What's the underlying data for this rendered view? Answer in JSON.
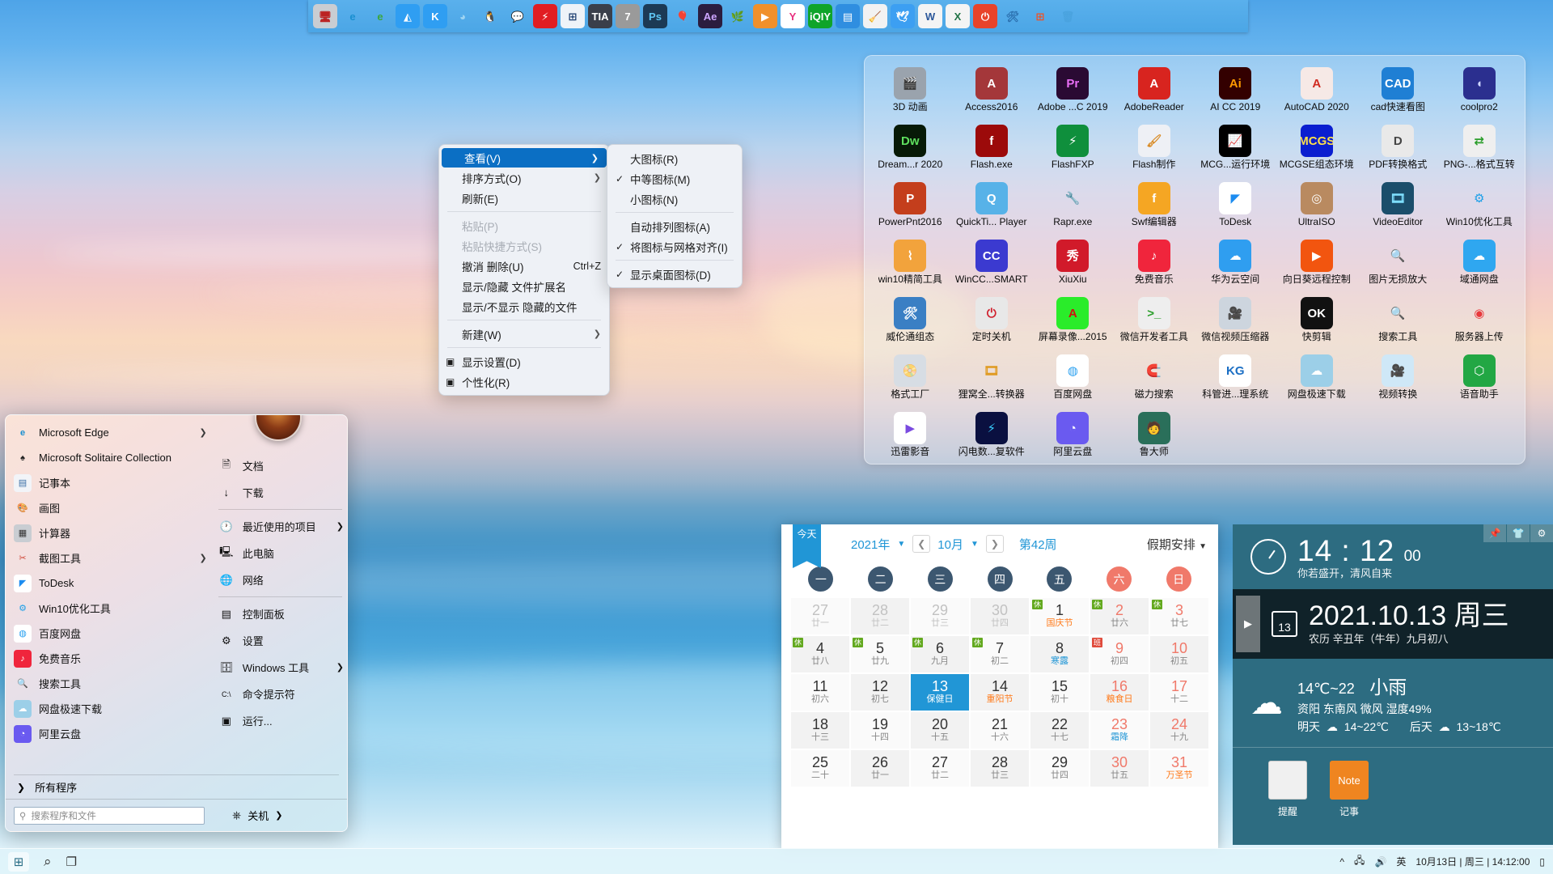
{
  "top_dock": {
    "icons": [
      {
        "name": "windows-optimizer-icon",
        "glyph": "🖥",
        "bg": "#c9cdd2",
        "fg": "#b22",
        "label": "优化大师"
      },
      {
        "name": "microsoft-edge-icon",
        "glyph": "e",
        "bg": "transparent",
        "fg": "#1a8fd0",
        "label": "Microsoft Edge"
      },
      {
        "name": "internet-explorer-icon",
        "glyph": "e",
        "bg": "transparent",
        "fg": "#3ba63b",
        "label": "Internet Explorer"
      },
      {
        "name": "maxthon-icon",
        "glyph": "◭",
        "bg": "#2f9ef2",
        "fg": "#fff",
        "label": "傲游浏览器"
      },
      {
        "name": "kingsoft-icon",
        "glyph": "K",
        "bg": "#2f9ef2",
        "fg": "#fff",
        "label": "金山"
      },
      {
        "name": "qqbrowser-icon",
        "glyph": "◕",
        "bg": "transparent",
        "fg": "#9fd4f2",
        "label": "QQ浏览器"
      },
      {
        "name": "qq-icon",
        "glyph": "🐧",
        "bg": "transparent",
        "fg": "#111",
        "label": "QQ"
      },
      {
        "name": "wechat-icon",
        "glyph": "💬",
        "bg": "transparent",
        "fg": "#3fbf4a",
        "label": "微信"
      },
      {
        "name": "danger-warning-icon",
        "glyph": "⚡",
        "bg": "#e11d22",
        "fg": "#fff",
        "label": "电工助手"
      },
      {
        "name": "plc-tool-icon",
        "glyph": "⊞",
        "bg": "#eef3f8",
        "fg": "#1a3c6e",
        "label": "PLC工具"
      },
      {
        "name": "tia-portal-v16-icon",
        "glyph": "TIA",
        "bg": "#3a3f4a",
        "fg": "#fff",
        "label": "TIA V16"
      },
      {
        "name": "step7-icon",
        "glyph": "7",
        "bg": "#9a9a9a",
        "fg": "#fff",
        "label": "STEP 7"
      },
      {
        "name": "photoshop-icon",
        "glyph": "Ps",
        "bg": "#1c3a55",
        "fg": "#5fc7f5",
        "label": "Photoshop"
      },
      {
        "name": "corel-icon",
        "glyph": "🎈",
        "bg": "transparent",
        "fg": "#e0a",
        "label": "CorelDRAW"
      },
      {
        "name": "after-effects-icon",
        "glyph": "Ae",
        "bg": "#2b1d3f",
        "fg": "#cda6ff",
        "label": "After Effects"
      },
      {
        "name": "evernote-icon",
        "glyph": "🌿",
        "bg": "transparent",
        "fg": "#7ac143",
        "label": "印象笔记"
      },
      {
        "name": "potplayer-icon",
        "glyph": "▶",
        "bg": "#f0902b",
        "fg": "#fff",
        "label": "播放器"
      },
      {
        "name": "youku-icon",
        "glyph": "Y",
        "bg": "#fff",
        "fg": "#e8317f",
        "label": "优酷"
      },
      {
        "name": "iqiyi-icon",
        "glyph": "iQIY",
        "bg": "#0fa42a",
        "fg": "#fff",
        "label": "爱奇艺"
      },
      {
        "name": "f6-tool-icon",
        "glyph": "▤",
        "bg": "#2f8ee0",
        "fg": "#fff",
        "label": "F6工具"
      },
      {
        "name": "cleaner-icon",
        "glyph": "🧹",
        "bg": "#f2f2f2",
        "fg": "#3a3",
        "label": "清理工具"
      },
      {
        "name": "swallow-icon",
        "glyph": "🕊",
        "bg": "#3c9ff2",
        "fg": "#fff",
        "label": "燕子"
      },
      {
        "name": "word-icon",
        "glyph": "W",
        "bg": "#f4f4f4",
        "fg": "#2b579a",
        "label": "Word"
      },
      {
        "name": "excel-icon",
        "glyph": "X",
        "bg": "#f4f4f4",
        "fg": "#217346",
        "label": "Excel"
      },
      {
        "name": "shutdown-icon",
        "glyph": "⏻",
        "bg": "#e8432a",
        "fg": "#fff",
        "label": "关机"
      },
      {
        "name": "toolbox-icon",
        "glyph": "🛠",
        "bg": "transparent",
        "fg": "#2b6fae",
        "label": "工具箱"
      },
      {
        "name": "windows-logo-icon",
        "glyph": "⊞",
        "bg": "transparent",
        "fg": "#f25022",
        "label": "Windows"
      },
      {
        "name": "recycle-bin-icon",
        "glyph": "🗑",
        "bg": "transparent",
        "fg": "#4aa3df",
        "label": "回收站"
      }
    ]
  },
  "desktop_icons": [
    {
      "label": "3D 动画",
      "glyph": "🎬",
      "bg": "#9aa3ad",
      "fg": "#fff"
    },
    {
      "label": "Access2016",
      "glyph": "A",
      "bg": "#a4373a",
      "fg": "#fff"
    },
    {
      "label": "Adobe ...C 2019",
      "glyph": "Pr",
      "bg": "#2a0a33",
      "fg": "#e96ef5"
    },
    {
      "label": "AdobeReader",
      "glyph": "A",
      "bg": "#d8241f",
      "fg": "#fff"
    },
    {
      "label": "AI CC 2019",
      "glyph": "Ai",
      "bg": "#330000",
      "fg": "#ff9a00"
    },
    {
      "label": "AutoCAD 2020",
      "glyph": "A",
      "bg": "#f6e9e6",
      "fg": "#d02a20"
    },
    {
      "label": "cad快速看图",
      "glyph": "CAD",
      "bg": "#1f7fd4",
      "fg": "#fff"
    },
    {
      "label": "coolpro2",
      "glyph": "◖",
      "bg": "#2b2f8f",
      "fg": "#cfd6ff"
    },
    {
      "label": "Dream...r 2020",
      "glyph": "Dw",
      "bg": "#071a07",
      "fg": "#5ee05e"
    },
    {
      "label": "Flash.exe",
      "glyph": "f",
      "bg": "#9c0a0a",
      "fg": "#fff"
    },
    {
      "label": "FlashFXP",
      "glyph": "⚡",
      "bg": "#0f8f3c",
      "fg": "#fff"
    },
    {
      "label": "Flash制作",
      "glyph": "🖌",
      "bg": "#eef0f5",
      "fg": "#d98c28"
    },
    {
      "label": "MCG...运行环境",
      "glyph": "📈",
      "bg": "#000000",
      "fg": "#2ef02e"
    },
    {
      "label": "MCGSE组态环境",
      "glyph": "MCGS",
      "bg": "#0a1ed0",
      "fg": "#ffe04a"
    },
    {
      "label": "PDF转换格式",
      "glyph": "D",
      "bg": "#e9e9e9",
      "fg": "#444"
    },
    {
      "label": "PNG-...格式互转",
      "glyph": "⇄",
      "bg": "#efefef",
      "fg": "#2b9e2b"
    },
    {
      "label": "PowerPnt2016",
      "glyph": "P",
      "bg": "#c43e1c",
      "fg": "#fff"
    },
    {
      "label": "QuickTi... Player",
      "glyph": "Q",
      "bg": "#57b2e8",
      "fg": "#fff"
    },
    {
      "label": "Rapr.exe",
      "glyph": "🔧",
      "bg": "transparent",
      "fg": "#333"
    },
    {
      "label": "Swf编辑器",
      "glyph": "f",
      "bg": "#f5a623",
      "fg": "#fff"
    },
    {
      "label": "ToDesk",
      "glyph": "◤",
      "bg": "#ffffff",
      "fg": "#1c8cf0"
    },
    {
      "label": "UltraISO",
      "glyph": "◎",
      "bg": "#b98a60",
      "fg": "#fff"
    },
    {
      "label": "VideoEditor",
      "glyph": "🎞",
      "bg": "#1b4e6b",
      "fg": "#7fe0ff"
    },
    {
      "label": "Win10优化工具",
      "glyph": "⚙",
      "bg": "transparent",
      "fg": "#1c9fe8"
    },
    {
      "label": "win10精简工具",
      "glyph": "⌇",
      "bg": "#f2a33c",
      "fg": "#fff"
    },
    {
      "label": "WinCC...SMART",
      "glyph": "CC",
      "bg": "#3b3ad0",
      "fg": "#fff"
    },
    {
      "label": "XiuXiu",
      "glyph": "秀",
      "bg": "#d11a2a",
      "fg": "#fff"
    },
    {
      "label": "免费音乐",
      "glyph": "♪",
      "bg": "#f0253c",
      "fg": "#fff"
    },
    {
      "label": "华为云空间",
      "glyph": "☁",
      "bg": "#2f9ef0",
      "fg": "#fff"
    },
    {
      "label": "向日葵远程控制",
      "glyph": "▶",
      "bg": "#f2550f",
      "fg": "#fff"
    },
    {
      "label": "图片无损放大",
      "glyph": "🔍",
      "bg": "transparent",
      "fg": "#c8a23a"
    },
    {
      "label": "域通网盘",
      "glyph": "☁",
      "bg": "#2fa7f0",
      "fg": "#fff"
    },
    {
      "label": "威伦通组态",
      "glyph": "🛠",
      "bg": "#3a7fc4",
      "fg": "#fff"
    },
    {
      "label": "定时关机",
      "glyph": "⏻",
      "bg": "#e8e8e8",
      "fg": "#d0212e"
    },
    {
      "label": "屏幕录像...2015",
      "glyph": "A",
      "bg": "#2aec2a",
      "fg": "#d01010"
    },
    {
      "label": "微信开发者工具",
      "glyph": ">_",
      "bg": "#eeeeee",
      "fg": "#2a9e2a"
    },
    {
      "label": "微信视频压缩器",
      "glyph": "🎥",
      "bg": "#cdd5de",
      "fg": "#3a4a5a"
    },
    {
      "label": "快剪辑",
      "glyph": "OK",
      "bg": "#111111",
      "fg": "#fff"
    },
    {
      "label": "搜索工具",
      "glyph": "🔍",
      "bg": "transparent",
      "fg": "#f08a1e"
    },
    {
      "label": "服务器上传",
      "glyph": "◉",
      "bg": "transparent",
      "fg": "#e8383c"
    },
    {
      "label": "格式工厂",
      "glyph": "📀",
      "bg": "#d7dde4",
      "fg": "#3a4a5a"
    },
    {
      "label": "狸窝全...转换器",
      "glyph": "🎞",
      "bg": "transparent",
      "fg": "#e09a20"
    },
    {
      "label": "百度网盘",
      "glyph": "◍",
      "bg": "#ffffff",
      "fg": "#2aa0f0"
    },
    {
      "label": "磁力搜索",
      "glyph": "🧲",
      "bg": "transparent",
      "fg": "#e03030"
    },
    {
      "label": "科管进...理系统",
      "glyph": "KG",
      "bg": "#ffffff",
      "fg": "#1c6fc4"
    },
    {
      "label": "网盘极速下载",
      "glyph": "☁",
      "bg": "#9ccfe8",
      "fg": "#fff"
    },
    {
      "label": "视频转换",
      "glyph": "🎥",
      "bg": "#cfe8f7",
      "fg": "#1c7fd0"
    },
    {
      "label": "语音助手",
      "glyph": "⬡",
      "bg": "#22a744",
      "fg": "#fff"
    },
    {
      "label": "迅雷影音",
      "glyph": "▶",
      "bg": "#ffffff",
      "fg": "#7a4ae0"
    },
    {
      "label": "闪电数...复软件",
      "glyph": "⚡",
      "bg": "#0a1040",
      "fg": "#3ad0ff"
    },
    {
      "label": "阿里云盘",
      "glyph": "◔",
      "bg": "#6a5af0",
      "fg": "#fff"
    },
    {
      "label": "鲁大师",
      "glyph": "🧑",
      "bg": "#2a6f5a",
      "fg": "#fff"
    }
  ],
  "context_menu": {
    "items": [
      {
        "label": "查看(V)",
        "selected": true,
        "submenu": true,
        "disabled": false
      },
      {
        "label": "排序方式(O)",
        "selected": false,
        "submenu": true,
        "disabled": false
      },
      {
        "label": "刷新(E)",
        "selected": false,
        "submenu": false,
        "disabled": false
      },
      {
        "sep": true
      },
      {
        "label": "粘贴(P)",
        "selected": false,
        "submenu": false,
        "disabled": true
      },
      {
        "label": "粘贴快捷方式(S)",
        "selected": false,
        "submenu": false,
        "disabled": true
      },
      {
        "label": "撤消 删除(U)",
        "selected": false,
        "submenu": false,
        "disabled": false,
        "accel": "Ctrl+Z"
      },
      {
        "label": "显示/隐藏 文件扩展名",
        "selected": false,
        "submenu": false,
        "disabled": false
      },
      {
        "label": "显示/不显示 隐藏的文件",
        "selected": false,
        "submenu": false,
        "disabled": false
      },
      {
        "sep": true
      },
      {
        "label": "新建(W)",
        "selected": false,
        "submenu": true,
        "disabled": false
      },
      {
        "sep": true
      },
      {
        "label": "显示设置(D)",
        "selected": false,
        "submenu": false,
        "disabled": false,
        "icon": "display-icon"
      },
      {
        "label": "个性化(R)",
        "selected": false,
        "submenu": false,
        "disabled": false,
        "icon": "personalize-icon"
      }
    ],
    "submenu": {
      "items": [
        {
          "label": "大图标(R)",
          "checked": false
        },
        {
          "label": "中等图标(M)",
          "checked": true
        },
        {
          "label": "小图标(N)",
          "checked": false
        },
        {
          "sep": true
        },
        {
          "label": "自动排列图标(A)",
          "checked": false
        },
        {
          "label": "将图标与网格对齐(I)",
          "checked": true
        },
        {
          "sep": true
        },
        {
          "label": "显示桌面图标(D)",
          "checked": true
        }
      ]
    }
  },
  "start_menu": {
    "left_items": [
      {
        "label": "Microsoft Edge",
        "glyph": "e",
        "bg": "transparent",
        "fg": "#1a8fd0",
        "arrow": true
      },
      {
        "label": "Microsoft Solitaire Collection",
        "glyph": "♠",
        "bg": "transparent",
        "fg": "#222",
        "arrow": false
      },
      {
        "label": "记事本",
        "glyph": "▤",
        "bg": "#f2f4f8",
        "fg": "#3a6ea5",
        "arrow": false
      },
      {
        "label": "画图",
        "glyph": "🎨",
        "bg": "transparent",
        "fg": "#d05",
        "arrow": false
      },
      {
        "label": "计算器",
        "glyph": "▦",
        "bg": "#c9cdd2",
        "fg": "#333",
        "arrow": false
      },
      {
        "label": "截图工具",
        "glyph": "✂",
        "bg": "transparent",
        "fg": "#d04a3a",
        "arrow": true
      },
      {
        "label": "ToDesk",
        "glyph": "◤",
        "bg": "#ffffff",
        "fg": "#1c8cf0",
        "arrow": false
      },
      {
        "label": "Win10优化工具",
        "glyph": "⚙",
        "bg": "transparent",
        "fg": "#1c9fe8",
        "arrow": false
      },
      {
        "label": "百度网盘",
        "glyph": "◍",
        "bg": "#ffffff",
        "fg": "#2aa0f0",
        "arrow": false
      },
      {
        "label": "免费音乐",
        "glyph": "♪",
        "bg": "#f0253c",
        "fg": "#fff",
        "arrow": false
      },
      {
        "label": "搜索工具",
        "glyph": "🔍",
        "bg": "transparent",
        "fg": "#f08a1e",
        "arrow": false
      },
      {
        "label": "网盘极速下载",
        "glyph": "☁",
        "bg": "#9ccfe8",
        "fg": "#fff",
        "arrow": false
      },
      {
        "label": "阿里云盘",
        "glyph": "◔",
        "bg": "#6a5af0",
        "fg": "#fff",
        "arrow": false
      }
    ],
    "right_items": [
      {
        "label": "文档",
        "glyph": "🗎",
        "arrow": false
      },
      {
        "label": "下载",
        "glyph": "↓",
        "arrow": false
      },
      {
        "sep": true
      },
      {
        "label": "最近使用的项目",
        "glyph": "🕐",
        "arrow": true
      },
      {
        "label": "此电脑",
        "glyph": "🖳",
        "arrow": false
      },
      {
        "label": "网络",
        "glyph": "🌐",
        "arrow": false
      },
      {
        "sep": true
      },
      {
        "label": "控制面板",
        "glyph": "▤",
        "arrow": false
      },
      {
        "label": "设置",
        "glyph": "⚙",
        "arrow": false
      },
      {
        "label": "Windows 工具",
        "glyph": "🗄",
        "arrow": true
      },
      {
        "label": "命令提示符",
        "glyph": "C:\\",
        "arrow": false
      },
      {
        "label": "运行...",
        "glyph": "▣",
        "arrow": false
      }
    ],
    "all_programs": "所有程序",
    "search_placeholder": "搜索程序和文件",
    "search_value": "",
    "shutdown_label": "关机"
  },
  "calendar": {
    "today_label": "今天",
    "year": "2021年",
    "month": "10月",
    "week": "第42周",
    "holiday_label": "假期安排",
    "dows": [
      "一",
      "二",
      "三",
      "四",
      "五",
      "六",
      "日"
    ],
    "days": [
      {
        "d": "27",
        "l": "廿一",
        "out": true
      },
      {
        "d": "28",
        "l": "廿二",
        "out": true,
        "alt": true
      },
      {
        "d": "29",
        "l": "廿三",
        "out": true
      },
      {
        "d": "30",
        "l": "廿四",
        "out": true,
        "alt": true
      },
      {
        "d": "1",
        "l": "国庆节",
        "fest": true,
        "tag": "休"
      },
      {
        "d": "2",
        "l": "廿六",
        "red": true,
        "tag": "休",
        "alt": true
      },
      {
        "d": "3",
        "l": "廿七",
        "red": true,
        "tag": "休"
      },
      {
        "d": "4",
        "l": "廿八",
        "tag": "休",
        "alt": true
      },
      {
        "d": "5",
        "l": "廿九",
        "tag": "休"
      },
      {
        "d": "6",
        "l": "九月",
        "tag": "休",
        "alt": true
      },
      {
        "d": "7",
        "l": "初二",
        "tag": "休"
      },
      {
        "d": "8",
        "l": "寒露",
        "term": true,
        "alt": true
      },
      {
        "d": "9",
        "l": "初四",
        "red": true,
        "tagw": "班"
      },
      {
        "d": "10",
        "l": "初五",
        "red": true,
        "alt": true
      },
      {
        "d": "11",
        "l": "初六"
      },
      {
        "d": "12",
        "l": "初七",
        "alt": true
      },
      {
        "d": "13",
        "l": "保健日",
        "sel": true
      },
      {
        "d": "14",
        "l": "重阳节",
        "fest": true,
        "alt": true
      },
      {
        "d": "15",
        "l": "初十"
      },
      {
        "d": "16",
        "l": "粮食日",
        "red": true,
        "fest": true,
        "alt": true
      },
      {
        "d": "17",
        "l": "十二",
        "red": true
      },
      {
        "d": "18",
        "l": "十三",
        "alt": true
      },
      {
        "d": "19",
        "l": "十四"
      },
      {
        "d": "20",
        "l": "十五",
        "alt": true
      },
      {
        "d": "21",
        "l": "十六"
      },
      {
        "d": "22",
        "l": "十七",
        "alt": true
      },
      {
        "d": "23",
        "l": "霜降",
        "red": true,
        "term": true
      },
      {
        "d": "24",
        "l": "十九",
        "red": true,
        "alt": true
      },
      {
        "d": "25",
        "l": "二十"
      },
      {
        "d": "26",
        "l": "廿一",
        "alt": true
      },
      {
        "d": "27",
        "l": "廿二"
      },
      {
        "d": "28",
        "l": "廿三",
        "alt": true
      },
      {
        "d": "29",
        "l": "廿四"
      },
      {
        "d": "30",
        "l": "廿五",
        "red": true,
        "alt": true
      },
      {
        "d": "31",
        "l": "万圣节",
        "red": true,
        "fest": true
      }
    ]
  },
  "widget": {
    "clock_time": "14 : 12",
    "clock_seconds": "00",
    "clock_motto": "你若盛开，清风自来",
    "date_main": "2021.10.13  周三",
    "date_lunar": "农历 辛丑年（牛年）九月初八",
    "date_badge": "13",
    "weather_temp": "14℃~22",
    "weather_desc": "小雨",
    "weather_detail": "资阳 东南风 微风 湿度49%",
    "weather_tomorrow_label": "明天",
    "weather_tomorrow_temp": "14~22℃",
    "weather_dayafter_label": "后天",
    "weather_dayafter_temp": "13~18℃",
    "note_reminder": "提醒",
    "note_memo": "记事",
    "note_memo_glyph": "Note",
    "tools": [
      {
        "name": "pin-icon",
        "glyph": "📌"
      },
      {
        "name": "skin-icon",
        "glyph": "👕"
      },
      {
        "name": "gear-icon",
        "glyph": "⚙"
      }
    ]
  },
  "taskbar": {
    "start_label": "⊞",
    "search_label": "⌕",
    "taskview_label": "❐",
    "tray_chevron": "^",
    "tray_network": "🖧",
    "tray_volume": "🔊",
    "tray_ime": "英",
    "clock": "10月13日 | 周三 | 14:12:00",
    "show_desktop": "▯"
  },
  "colors": {
    "accent": "#0b6fc4",
    "calendar_accent": "#2196d6",
    "widget_bg": "#2d6c81",
    "widget_dark": "#102229",
    "rest_tag": "#63a91f",
    "work_tag": "#e04b3c"
  }
}
